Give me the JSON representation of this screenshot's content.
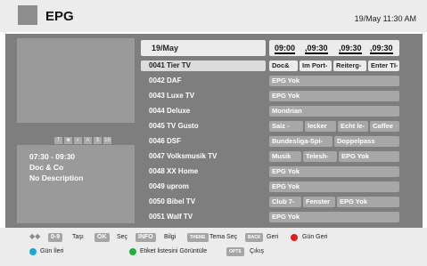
{
  "header": {
    "title": "EPG",
    "datetime": "19/May 11:30 AM"
  },
  "attr_icons": [
    "T",
    "■",
    "◐",
    "A",
    "$",
    "16"
  ],
  "info": {
    "time": "07:30 - 09:30",
    "program": "Doc & Co",
    "description": "No Description"
  },
  "guide": {
    "date": "19/May",
    "times": [
      "09:00",
      ",09:30",
      ",09:30",
      ",09:30"
    ],
    "channels": [
      {
        "label": "0041 Tier TV",
        "selected": true,
        "programs": [
          "Doc&",
          "Im Port-",
          "Reiterg-",
          "Enter TI-"
        ]
      },
      {
        "label": "0042 DAF",
        "programs": [
          "EPG Yok"
        ]
      },
      {
        "label": "0043 Luxe TV",
        "programs": [
          "EPG Yok"
        ]
      },
      {
        "label": "0044 Deluxe",
        "programs": [
          "Mondrian"
        ]
      },
      {
        "label": "0045 TV Gusto",
        "programs": [
          "Saiz -",
          "lecker",
          "Echt le-",
          "Caffee"
        ]
      },
      {
        "label": "0046 DSF",
        "programs": [
          "Bundesliga-Spi-",
          "Doppelpass"
        ]
      },
      {
        "label": "0047 Volksmusik TV",
        "programs": [
          "Musik",
          "Telesh-",
          "EPG Yok"
        ]
      },
      {
        "label": "0048 XX Home",
        "programs": [
          "EPG Yok"
        ]
      },
      {
        "label": "0049 uprom",
        "programs": [
          "EPG Yok"
        ]
      },
      {
        "label": "0050 Bibel TV",
        "programs": [
          "Club 7-",
          "Fenster",
          "EPG Yok"
        ]
      },
      {
        "label": "0051 Walf TV",
        "programs": [
          "EPG Yok"
        ]
      }
    ]
  },
  "footer": {
    "nav_key": "0-9",
    "move_label": "Taşı",
    "ok_key": "OK",
    "select_label": "Seç",
    "info_key": "INFO",
    "info_label": "Bilgi",
    "theme_key": "THEME",
    "theme_label": "Tema Seç",
    "back_key": "BACK",
    "back_label": "Geri",
    "red_label": "Gün Geri",
    "blue_label": "Gün İleri",
    "green_label": "Etiket listesini Görüntüle",
    "opts_key": "OPTS",
    "exit_label": "Çıkış",
    "colors": {
      "red": "#e02020",
      "blue": "#18a8e0",
      "green": "#20b040"
    }
  }
}
